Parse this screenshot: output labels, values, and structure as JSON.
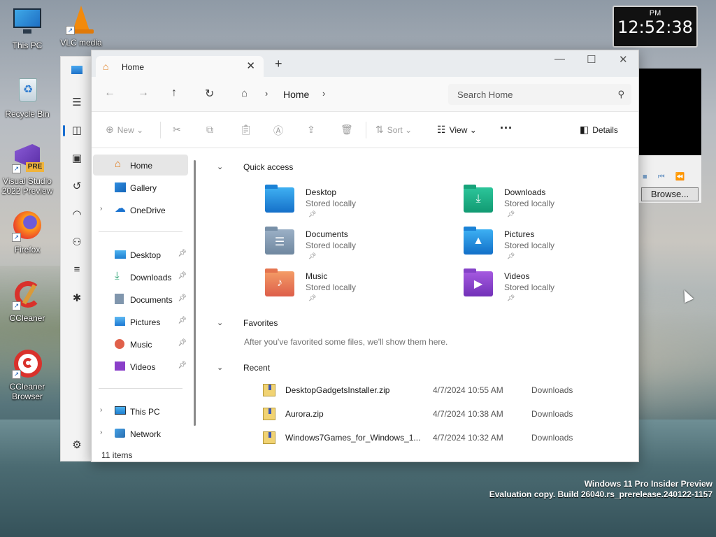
{
  "desktop": {
    "icons": [
      {
        "label": "This PC"
      },
      {
        "label": "VLC media"
      },
      {
        "label": "Recycle Bin"
      },
      {
        "label": "Visual Studio 2022 Preview"
      },
      {
        "label": "Firefox"
      },
      {
        "label": "CCleaner"
      },
      {
        "label": "CCleaner Browser"
      }
    ],
    "vs_badge": "PRE",
    "watermark_line1": "Windows 11 Pro Insider Preview",
    "watermark_line2": "Evaluation copy. Build 26040.rs_prerelease.240122-1157"
  },
  "clock": {
    "ampm": "PM",
    "time": "12:52:38"
  },
  "vlc": {
    "browse_label": "Browse..."
  },
  "explorer": {
    "tab_title": "Home",
    "new_tab_label": "+",
    "breadcrumb": "Home",
    "search_placeholder": "Search Home",
    "commands": {
      "new": "New",
      "sort": "Sort",
      "view": "View",
      "more": "···",
      "details": "Details"
    },
    "nav": {
      "top": [
        {
          "label": "Home"
        },
        {
          "label": "Gallery"
        },
        {
          "label": "OneDrive"
        }
      ],
      "pinned": [
        {
          "label": "Desktop"
        },
        {
          "label": "Downloads"
        },
        {
          "label": "Documents"
        },
        {
          "label": "Pictures"
        },
        {
          "label": "Music"
        },
        {
          "label": "Videos"
        }
      ],
      "bottom": [
        {
          "label": "This PC"
        },
        {
          "label": "Network"
        }
      ]
    },
    "sections": {
      "quick_access": "Quick access",
      "favorites": "Favorites",
      "favorites_empty": "After you've favorited some files, we'll show them here.",
      "recent": "Recent"
    },
    "quick_access": [
      {
        "name": "Desktop",
        "sub": "Stored locally"
      },
      {
        "name": "Downloads",
        "sub": "Stored locally"
      },
      {
        "name": "Documents",
        "sub": "Stored locally"
      },
      {
        "name": "Pictures",
        "sub": "Stored locally"
      },
      {
        "name": "Music",
        "sub": "Stored locally"
      },
      {
        "name": "Videos",
        "sub": "Stored locally"
      }
    ],
    "recent": [
      {
        "name": "DesktopGadgetsInstaller.zip",
        "date": "4/7/2024 10:55 AM",
        "location": "Downloads"
      },
      {
        "name": "Aurora.zip",
        "date": "4/7/2024 10:38 AM",
        "location": "Downloads"
      },
      {
        "name": "Windows7Games_for_Windows_1...",
        "date": "4/7/2024 10:32 AM",
        "location": "Downloads"
      }
    ],
    "status": "11 items"
  },
  "colors": {
    "accent": "#1a6fd1",
    "home_icon": "#e07a1a"
  }
}
